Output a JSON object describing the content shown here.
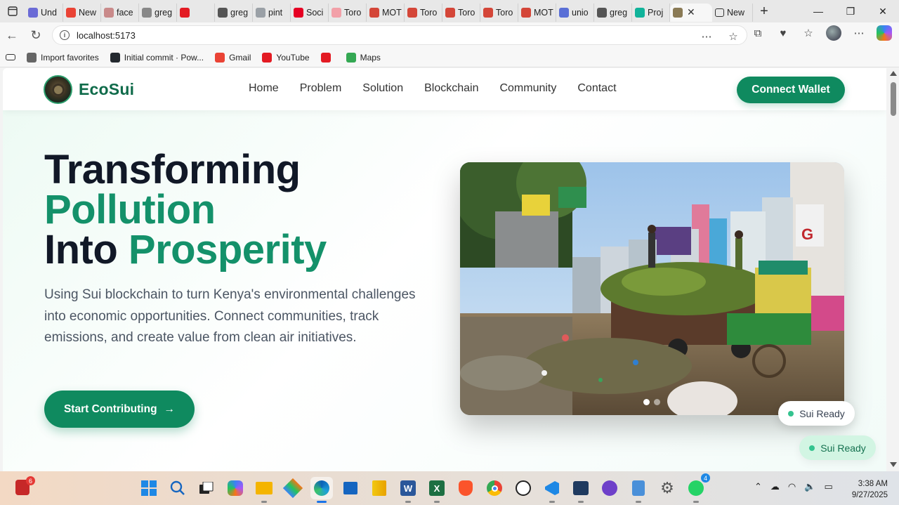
{
  "browser": {
    "tabs": [
      {
        "label": "Und",
        "color": "#6b6bd6"
      },
      {
        "label": "New",
        "color": "#ea4335"
      },
      {
        "label": "face",
        "color": "#c98a8a"
      },
      {
        "label": "greg",
        "color": "#888888"
      },
      {
        "label": "",
        "color": "#e31b23"
      },
      {
        "label": "greg",
        "color": "#555555"
      },
      {
        "label": "pint",
        "color": "#9aa0a6"
      },
      {
        "label": "Soci",
        "color": "#e60023"
      },
      {
        "label": "Toro",
        "color": "#f2a0a8"
      },
      {
        "label": "MOT",
        "color": "#d44638"
      },
      {
        "label": "Toro",
        "color": "#d44638"
      },
      {
        "label": "Toro",
        "color": "#d44638"
      },
      {
        "label": "Toro",
        "color": "#d44638"
      },
      {
        "label": "MOT",
        "color": "#d44638"
      },
      {
        "label": "unio",
        "color": "#5a6fd6"
      },
      {
        "label": "greg",
        "color": "#555555"
      },
      {
        "label": "Proj",
        "color": "#10b39a"
      }
    ],
    "active_tab_close": "✕",
    "after_tab_label": "New",
    "address": "localhost:5173",
    "favorites": [
      {
        "label": "Import favorites",
        "color": "#666666"
      },
      {
        "label": "Initial commit · Pow...",
        "color": "#24292f"
      },
      {
        "label": "Gmail",
        "color": "#ea4335"
      },
      {
        "label": "YouTube",
        "color": "#e31b23"
      },
      {
        "label": "",
        "color": "#e31b23"
      },
      {
        "label": "Maps",
        "color": "#34a853"
      }
    ]
  },
  "site": {
    "brand": "EcoSui",
    "nav": [
      "Home",
      "Problem",
      "Solution",
      "Blockchain",
      "Community",
      "Contact"
    ],
    "connect_label": "Connect Wallet",
    "hero": {
      "line1": "Transforming",
      "line2": "Pollution",
      "line3a": "Into",
      "line3b": "Prosperity",
      "description": "Using Sui blockchain to turn Kenya's environmental challenges into economic opportunities. Connect communities, track emissions, and create value from clean air initiatives.",
      "cta_label": "Start Contributing",
      "cta_arrow": "→"
    },
    "badge_top": "Sui Ready",
    "badge_bottom": "Sui Ready",
    "colors": {
      "brand_green": "#0f8a5f",
      "heading_green": "#14916a",
      "heading_dark": "#111827"
    }
  },
  "taskbar": {
    "weather_count": "6",
    "whatsapp_count": "4",
    "time": "3:38 AM",
    "date": "9/27/2025"
  }
}
